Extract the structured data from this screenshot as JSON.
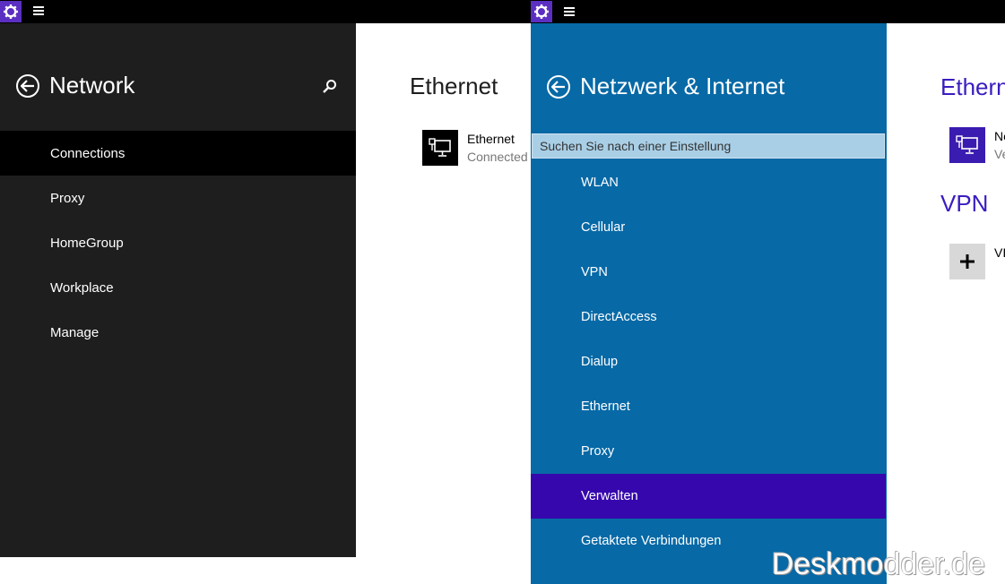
{
  "left_window": {
    "page_title": "Network",
    "nav": [
      {
        "label": "Connections",
        "selected": true
      },
      {
        "label": "Proxy"
      },
      {
        "label": "HomeGroup"
      },
      {
        "label": "Workplace"
      },
      {
        "label": "Manage"
      }
    ],
    "content": {
      "section_title": "Ethernet",
      "item_title": "Ethernet",
      "item_status": "Connected"
    }
  },
  "right_window": {
    "page_title": "Netzwerk & Internet",
    "search_placeholder": "Suchen Sie nach einer Einstellung",
    "nav": [
      {
        "label": "WLAN"
      },
      {
        "label": "Cellular"
      },
      {
        "label": "VPN"
      },
      {
        "label": "DirectAccess"
      },
      {
        "label": "Dialup"
      },
      {
        "label": "Ethernet"
      },
      {
        "label": "Proxy"
      },
      {
        "label": "Verwalten",
        "selected": true
      },
      {
        "label": "Getaktete Verbindungen"
      }
    ],
    "content": {
      "section_ethernet_title": "Ethern",
      "ethernet_item_title": "Ne",
      "ethernet_item_status": "Ve",
      "section_vpn_title": "VPN",
      "vpn_item_title": "VI"
    }
  },
  "watermark": "Deskmodder.de",
  "colors": {
    "accent_purple": "#3607ad",
    "blue_panel": "#0769a6",
    "dark_panel": "#1e1e1e"
  }
}
